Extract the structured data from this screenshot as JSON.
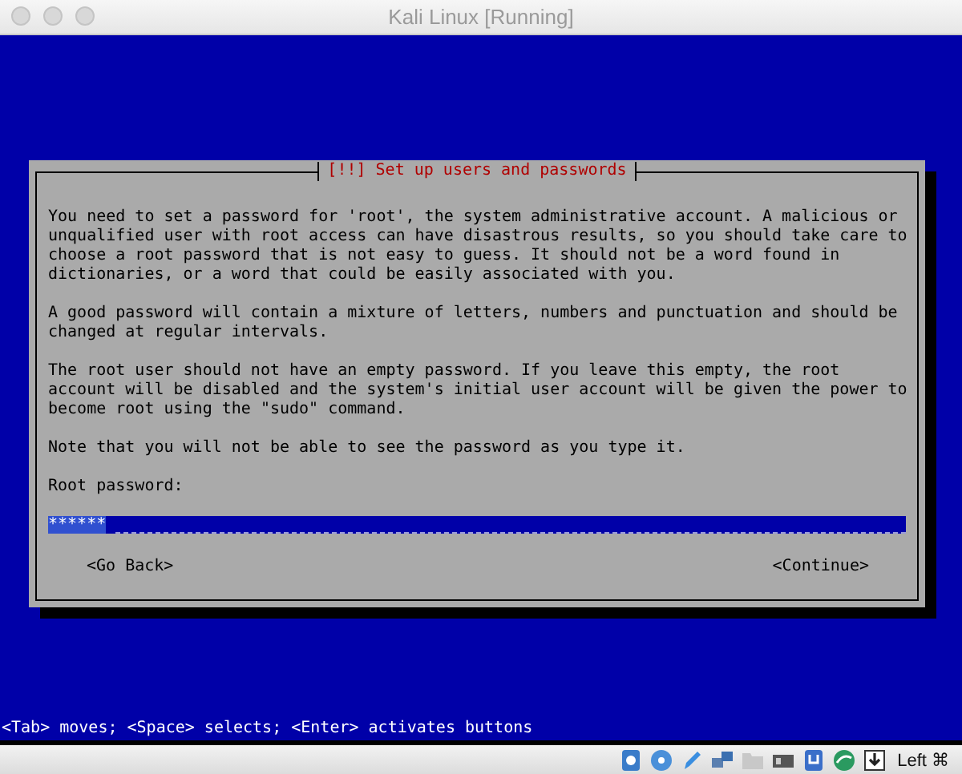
{
  "window": {
    "title": "Kali Linux [Running]"
  },
  "dialog": {
    "title": "[!!] Set up users and passwords",
    "paragraphs": [
      "You need to set a password for 'root', the system administrative account. A malicious or\nunqualified user with root access can have disastrous results, so you should take care to\nchoose a root password that is not easy to guess. It should not be a word found in\ndictionaries, or a word that could be easily associated with you.",
      "A good password will contain a mixture of letters, numbers and punctuation and should be\nchanged at regular intervals.",
      "The root user should not have an empty password. If you leave this empty, the root\naccount will be disabled and the system's initial user account will be given the power to\nbecome root using the \"sudo\" command.",
      "Note that you will not be able to see the password as you type it."
    ],
    "field_label": "Root password:",
    "password": {
      "value": "******"
    },
    "buttons": [
      "<Go Back>",
      "<Continue>"
    ]
  },
  "help_line": "<Tab> moves; <Space> selects; <Enter> activates buttons",
  "status_bar": {
    "key_label": "Left ⌘"
  }
}
